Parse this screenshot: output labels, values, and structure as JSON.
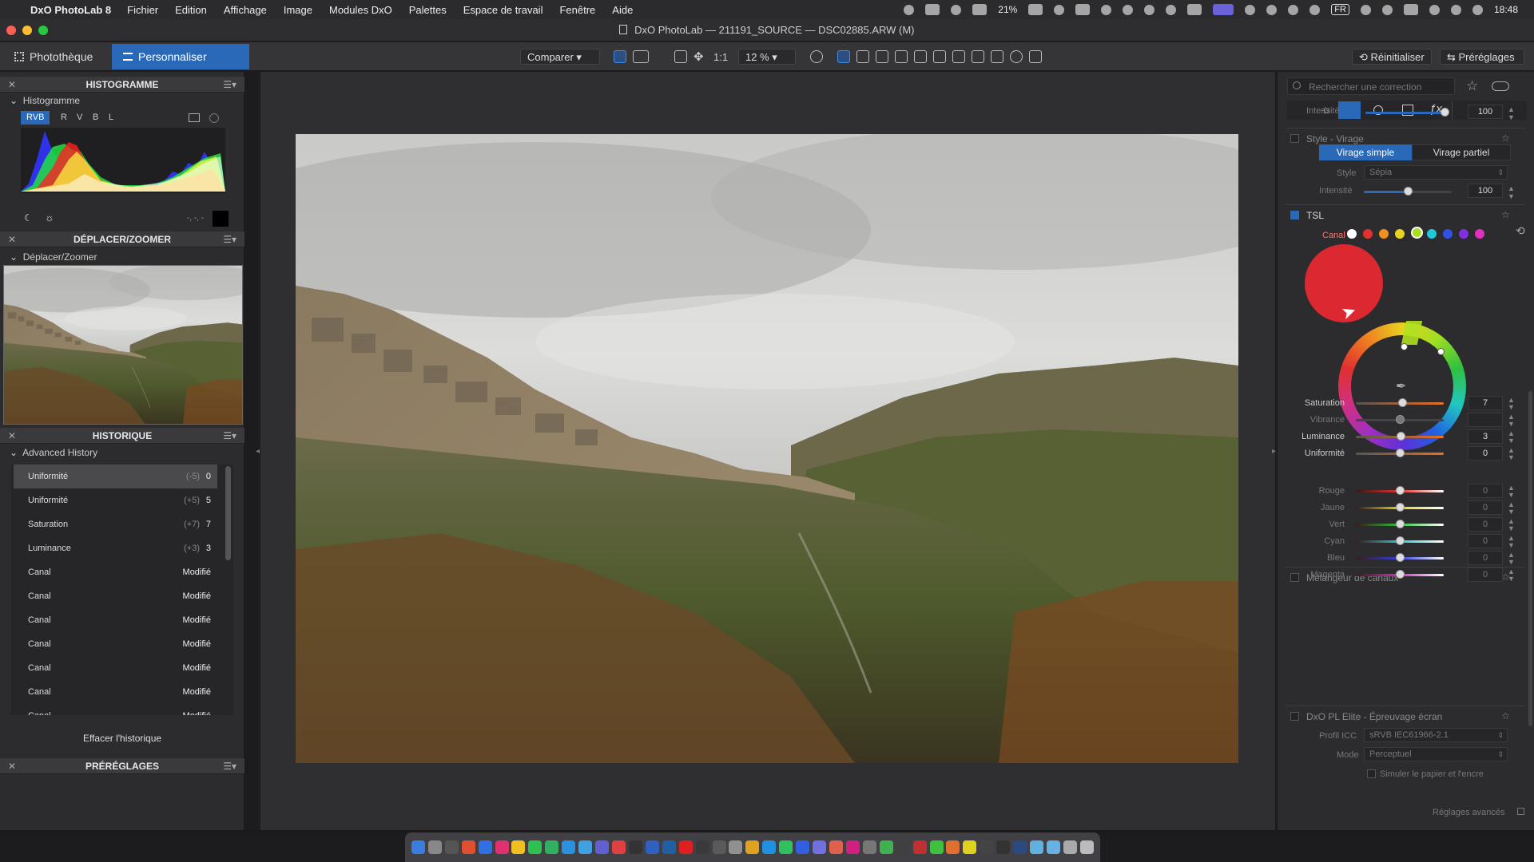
{
  "menubar": {
    "app_name": "DxO PhotoLab 8",
    "items": [
      "Fichier",
      "Edition",
      "Affichage",
      "Image",
      "Modules DxO",
      "Palettes",
      "Espace de travail",
      "Fenêtre",
      "Aide"
    ],
    "battery": "21%",
    "input_source": "FR",
    "clock": "18:48"
  },
  "window": {
    "title": "DxO PhotoLab — 211191_SOURCE — DSC02885.ARW (M)"
  },
  "toolbar": {
    "tab_library": "Photothèque",
    "tab_customize": "Personnaliser",
    "compare_label": "Comparer",
    "fit_label": "1:1",
    "zoom_value": "12 %",
    "reset_label": "Réinitialiser",
    "presets_label": "Préréglages"
  },
  "histogram": {
    "panel_title": "HISTOGRAMME",
    "sub_title": "Histogramme",
    "channels": [
      "RVB",
      "R",
      "V",
      "B",
      "L"
    ],
    "readout": "-, -, -"
  },
  "navigator": {
    "panel_title": "DÉPLACER/ZOOMER",
    "sub_title": "Déplacer/Zoomer"
  },
  "history": {
    "panel_title": "HISTORIQUE",
    "sub_title": "Advanced History",
    "rows": [
      {
        "label": "Uniformité",
        "delta": "(-5)",
        "value": "0"
      },
      {
        "label": "Uniformité",
        "delta": "(+5)",
        "value": "5"
      },
      {
        "label": "Saturation",
        "delta": "(+7)",
        "value": "7"
      },
      {
        "label": "Luminance",
        "delta": "(+3)",
        "value": "3"
      },
      {
        "label": "Canal",
        "delta": "",
        "value": "Modifié"
      },
      {
        "label": "Canal",
        "delta": "",
        "value": "Modifié"
      },
      {
        "label": "Canal",
        "delta": "",
        "value": "Modifié"
      },
      {
        "label": "Canal",
        "delta": "",
        "value": "Modifié"
      },
      {
        "label": "Canal",
        "delta": "",
        "value": "Modifié"
      },
      {
        "label": "Canal",
        "delta": "",
        "value": "Modifié"
      },
      {
        "label": "Canal",
        "delta": "",
        "value": "Modifié"
      }
    ],
    "clear_label": "Effacer l'historique"
  },
  "presets_panel": {
    "panel_title": "PRÉRÉGLAGES"
  },
  "right": {
    "search_placeholder": "Rechercher une correction",
    "intensity_top": {
      "label": "Intensité",
      "value": "100",
      "level": 100
    },
    "style_virage": {
      "title": "Style - Virage",
      "btn_simple": "Virage simple",
      "btn_partial": "Virage partiel",
      "style_label": "Style",
      "style_value": "Sépia",
      "intensity_label": "Intensité",
      "intensity_value": "100",
      "level": 50
    },
    "tsl": {
      "title": "TSL",
      "channel_label": "Canal",
      "channel_colors": [
        "#ffffff",
        "#e53030",
        "#f09020",
        "#e8d420",
        "#a8e020",
        "#20c8d8",
        "#3050e8",
        "#8030e0",
        "#e030c0"
      ],
      "sliders": [
        {
          "label": "Saturation",
          "value": "7",
          "level": 53,
          "dim": false
        },
        {
          "label": "Vibrance",
          "value": "",
          "level": 50,
          "dim": true
        },
        {
          "label": "Luminance",
          "value": "3",
          "level": 51,
          "dim": false
        },
        {
          "label": "Uniformité",
          "value": "0",
          "level": 50,
          "dim": false
        }
      ]
    },
    "mixer": {
      "title": "Mélangeur de canaux",
      "rows": [
        {
          "label": "Rouge",
          "value": "0",
          "color": "#e03030"
        },
        {
          "label": "Jaune",
          "value": "0",
          "color": "#e8d020"
        },
        {
          "label": "Vert",
          "value": "0",
          "color": "#30c040"
        },
        {
          "label": "Cyan",
          "value": "0",
          "color": "#30c8d8"
        },
        {
          "label": "Bleu",
          "value": "0",
          "color": "#3040e0"
        },
        {
          "label": "Magenta",
          "value": "0",
          "color": "#d030c0"
        }
      ]
    },
    "softproof": {
      "title": "DxO PL Elite - Épreuvage écran",
      "icc_label": "Profil ICC",
      "icc_value": "sRVB IEC61966-2.1",
      "mode_label": "Mode",
      "mode_value": "Perceptuel",
      "simulate_label": "Simuler le papier et l'encre"
    },
    "advanced_label": "Réglages avancés"
  }
}
